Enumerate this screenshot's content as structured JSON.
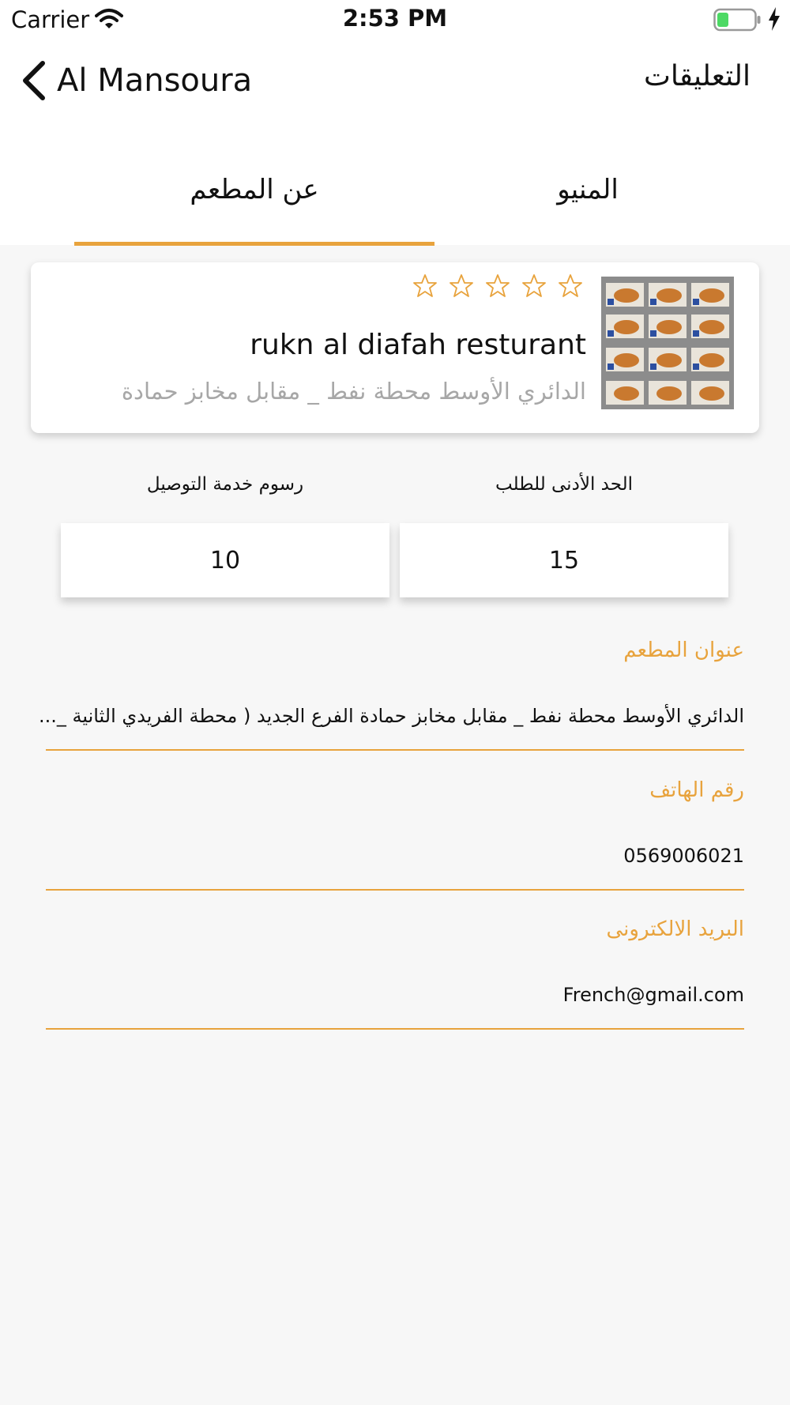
{
  "status_bar": {
    "carrier": "Carrier",
    "time": "2:53 PM",
    "icons": [
      "wifi-icon",
      "battery-icon",
      "charging-icon"
    ],
    "battery_color": "#4cd964"
  },
  "nav": {
    "back_label": "Al Mansoura",
    "back_icon": "chevron-left-icon",
    "reviews_label": "التعليقات"
  },
  "tabs": [
    {
      "label": "عن المطعم",
      "selected": true
    },
    {
      "label": "المنيو",
      "selected": false
    }
  ],
  "restaurant": {
    "name": "rukn al diafah resturant",
    "address": "الدائري الأوسط محطة نفط _ مقابل مخابز حمادة",
    "rating": 0,
    "max_rating": 5,
    "thumbnail": "menu-image"
  },
  "info": {
    "delivery_fee_label": "رسوم خدمة التوصيل",
    "delivery_fee_value": "10",
    "minimum_order_label": "الحد الأدنى للطلب",
    "minimum_order_value": "15"
  },
  "fields": {
    "address_label": "عنوان المطعم",
    "address_value": "الدائري الأوسط محطة نفط _ مقابل مخابز حمادة  الفرع الجديد ( محطة الفريدي الثانية _...",
    "phone_label": "رقم الهاتف",
    "phone_value": "0569006021",
    "email_label": "البريد الالكترونى",
    "email_value": "French@gmail.com"
  },
  "colors": {
    "accent": "#e8a33d",
    "background": "#f7f7f7",
    "muted_text": "#a7a7a7"
  }
}
